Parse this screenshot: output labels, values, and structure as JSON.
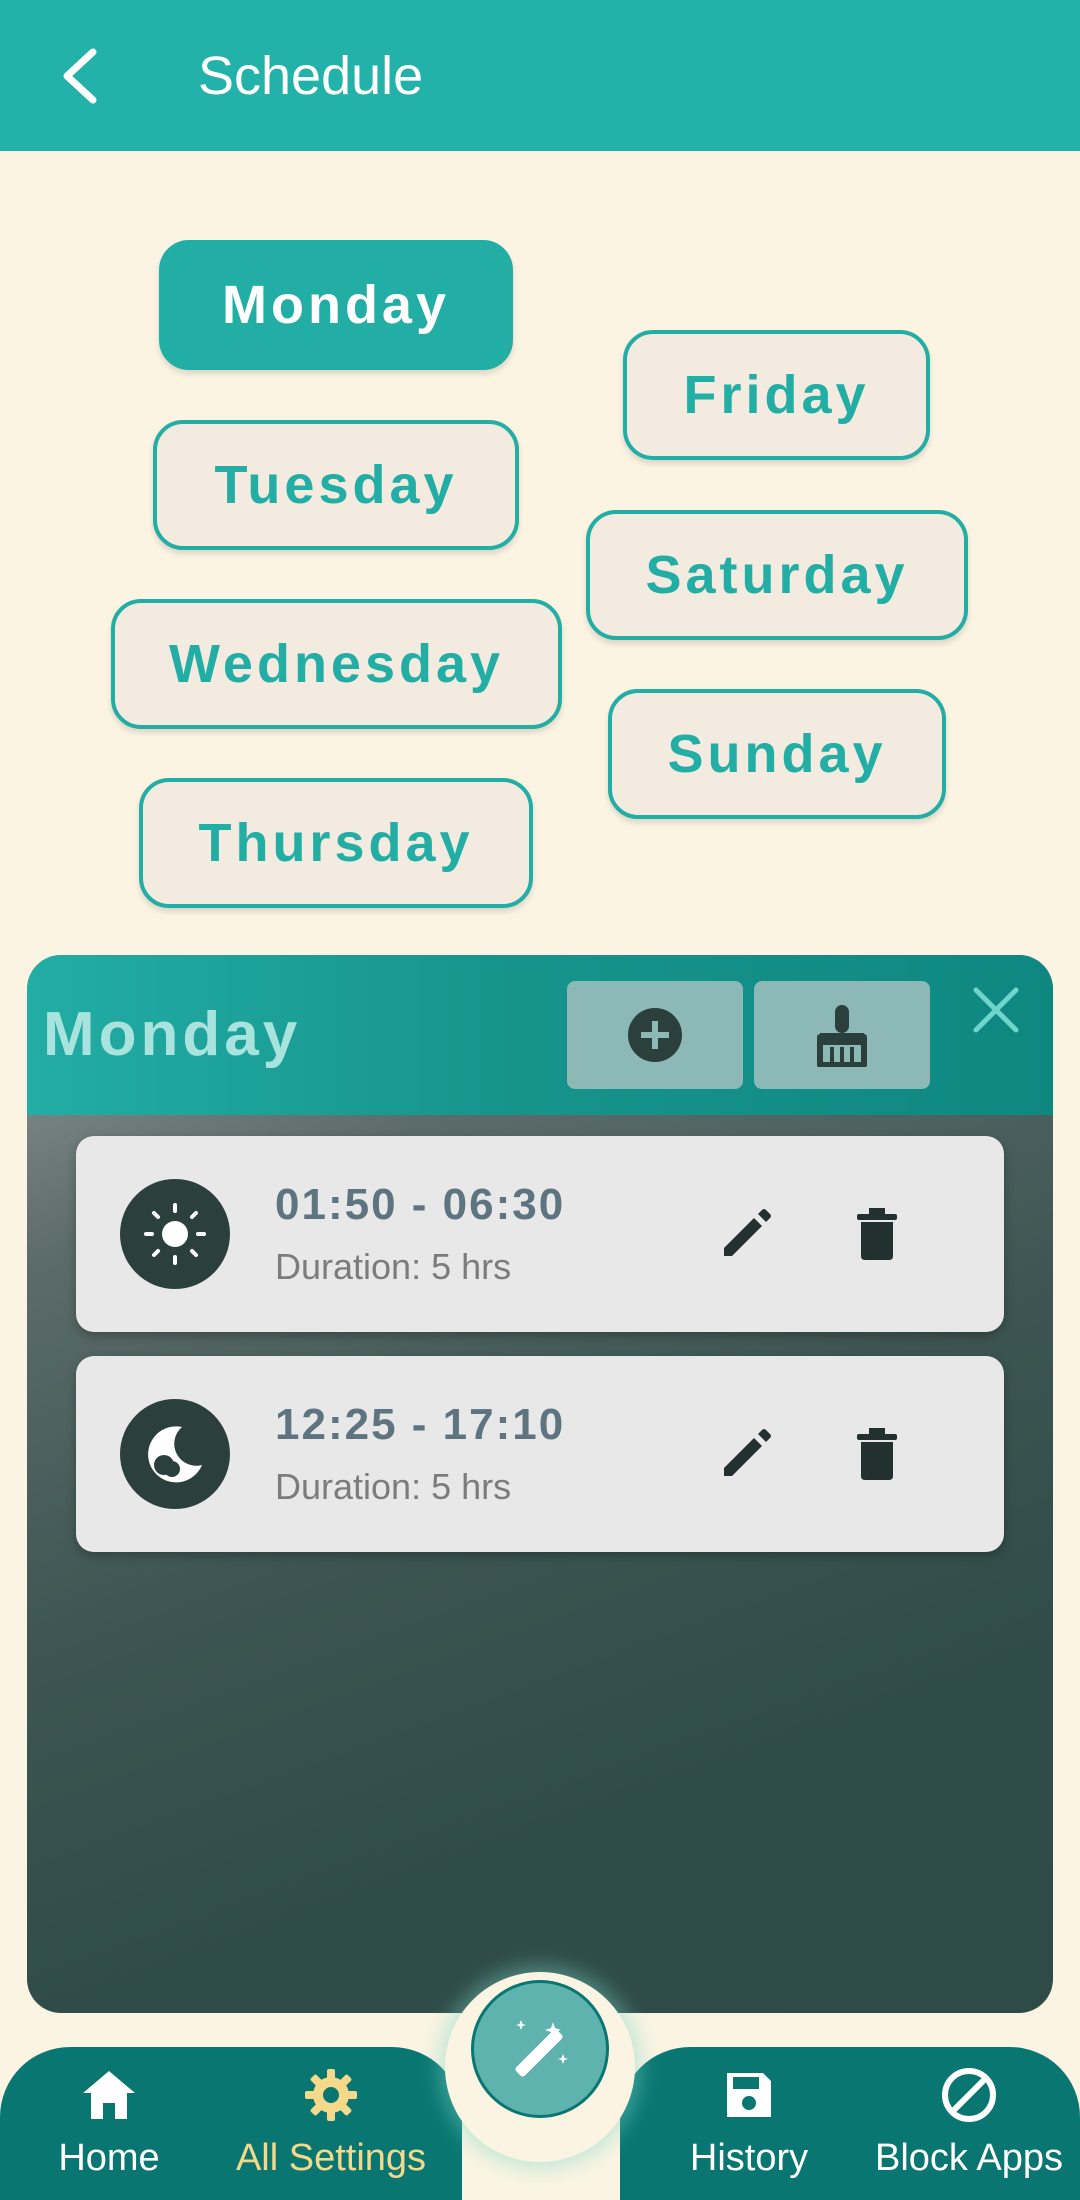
{
  "appbar": {
    "title": "Schedule",
    "background": "#22B2AA"
  },
  "days": {
    "monday": "Monday",
    "tuesday": "Tuesday",
    "wednesday": "Wednesday",
    "thursday": "Thursday",
    "friday": "Friday",
    "saturday": "Saturday",
    "sunday": "Sunday",
    "selected": "Monday"
  },
  "panel": {
    "title": "Monday",
    "add_icon": "add-circle-icon",
    "clear_icon": "broom-icon",
    "close_icon": "close-icon"
  },
  "entries": [
    {
      "time": "01:50 - 06:30",
      "duration": "Duration: 5 hrs",
      "icon": "sun-icon"
    },
    {
      "time": "12:25 - 17:10",
      "duration": "Duration: 5 hrs",
      "icon": "moon-icon"
    }
  ],
  "nav": {
    "home": "Home",
    "settings": "All Settings",
    "history": "History",
    "block_apps": "Block Apps",
    "fab_icon": "magic-wand-icon",
    "active": "All Settings"
  },
  "colors": {
    "accent": "#22ADA5",
    "nav_background": "#0A7672",
    "active_nav": "#F4D98A",
    "page_background": "#FBF4E3"
  }
}
